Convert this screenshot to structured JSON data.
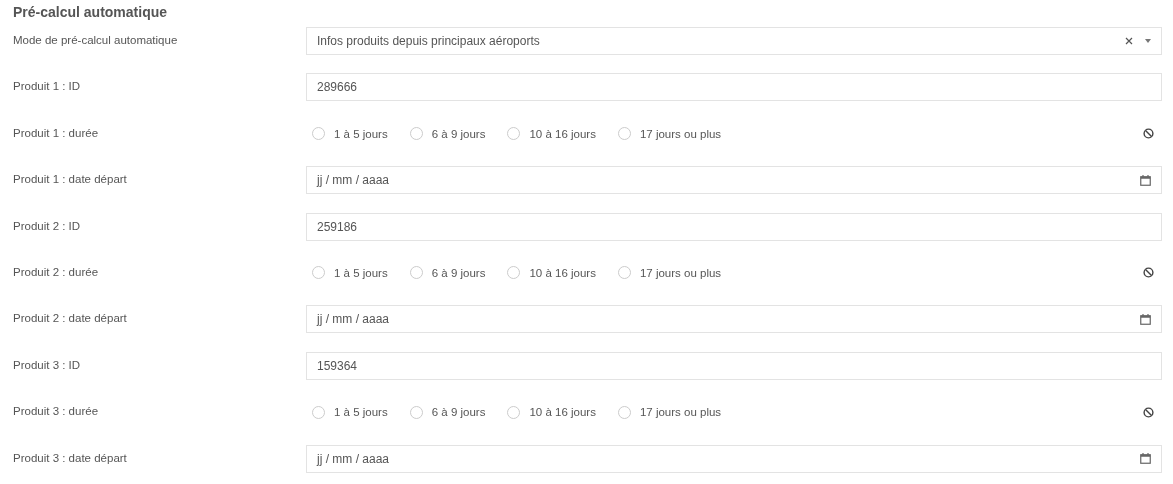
{
  "section": {
    "title": "Pré-calcul automatique"
  },
  "fields": [
    {
      "kind": "select",
      "label": "Mode de pré-calcul automatique",
      "value": "Infos produits depuis principaux aéroports"
    },
    {
      "kind": "text",
      "label": "Produit 1 : ID",
      "value": "289666"
    },
    {
      "kind": "radio",
      "label": "Produit 1 : durée",
      "options": [
        {
          "label": "1 à 5 jours",
          "selected": false
        },
        {
          "label": "6 à 9 jours",
          "selected": false
        },
        {
          "label": "10 à 16 jours",
          "selected": false
        },
        {
          "label": "17 jours ou plus",
          "selected": false
        }
      ]
    },
    {
      "kind": "date",
      "label": "Produit 1 : date départ",
      "placeholder": "jj / mm / aaaa"
    },
    {
      "kind": "text",
      "label": "Produit 2 : ID",
      "value": "259186"
    },
    {
      "kind": "radio",
      "label": "Produit 2 : durée",
      "options": [
        {
          "label": "1 à 5 jours",
          "selected": false
        },
        {
          "label": "6 à 9 jours",
          "selected": false
        },
        {
          "label": "10 à 16 jours",
          "selected": false
        },
        {
          "label": "17 jours ou plus",
          "selected": false
        }
      ]
    },
    {
      "kind": "date",
      "label": "Produit 2 : date départ",
      "placeholder": "jj / mm / aaaa"
    },
    {
      "kind": "text",
      "label": "Produit 3 : ID",
      "value": "159364"
    },
    {
      "kind": "radio",
      "label": "Produit 3 : durée",
      "options": [
        {
          "label": "1 à 5 jours",
          "selected": false
        },
        {
          "label": "6 à 9 jours",
          "selected": false
        },
        {
          "label": "10 à 16 jours",
          "selected": false
        },
        {
          "label": "17 jours ou plus",
          "selected": false
        }
      ]
    },
    {
      "kind": "date",
      "label": "Produit 3 : date départ",
      "placeholder": "jj / mm / aaaa"
    }
  ]
}
